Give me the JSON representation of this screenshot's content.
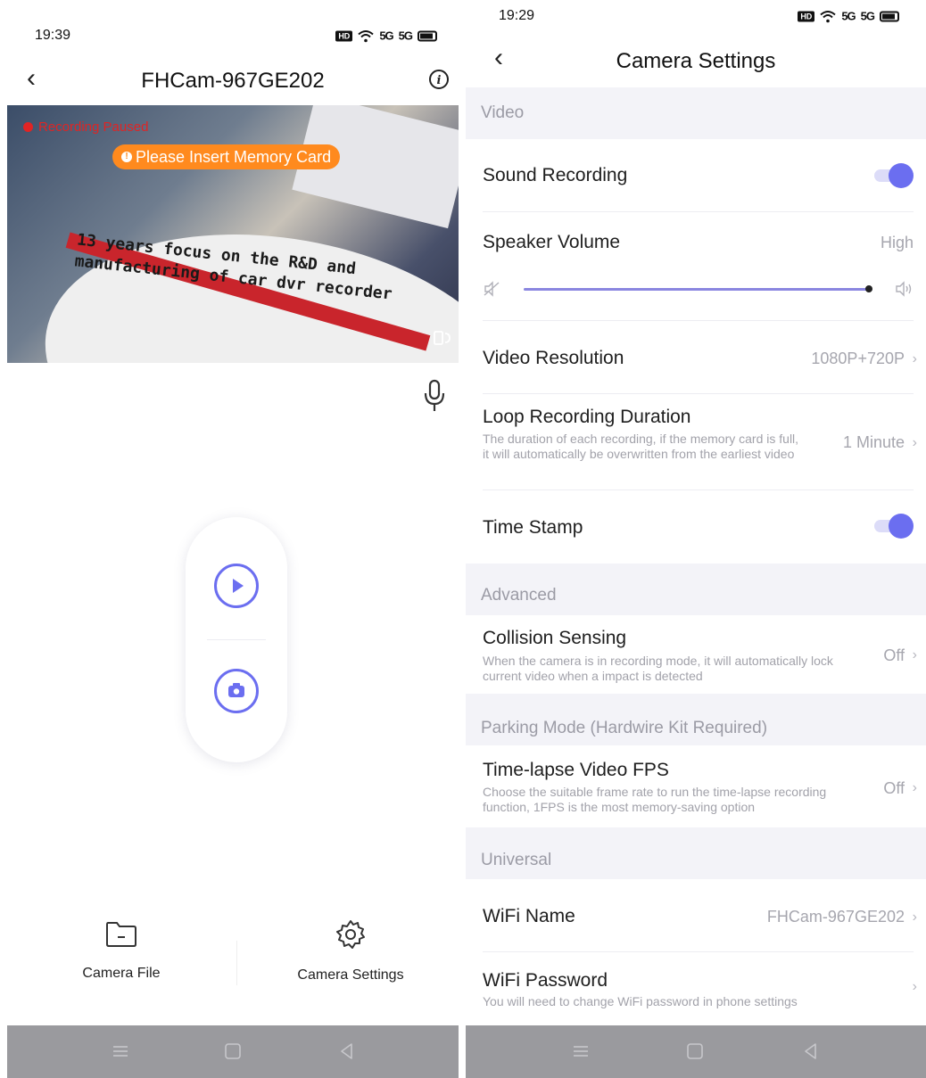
{
  "left": {
    "status": {
      "time": "19:39",
      "hd": "HD",
      "signal1": "5G",
      "signal2": "5G"
    },
    "header": {
      "title": "FHCam-967GE202"
    },
    "video": {
      "rec_status": "Recording Paused",
      "alert": "Please Insert Memory Card",
      "slogan_line1": "13 years focus on the R&D and",
      "slogan_line2": "manufacturing of car dvr recorder"
    },
    "nav": {
      "file_label": "Camera File",
      "settings_label": "Camera Settings"
    }
  },
  "right": {
    "status": {
      "time": "19:29",
      "hd": "HD",
      "signal1": "5G",
      "signal2": "5G"
    },
    "header": {
      "title": "Camera Settings"
    },
    "sections": {
      "video": "Video",
      "advanced": "Advanced",
      "parking": "Parking Mode (Hardwire Kit Required)",
      "universal": "Universal"
    },
    "rows": {
      "sound_recording": {
        "title": "Sound Recording",
        "enabled": true
      },
      "speaker_volume": {
        "title": "Speaker Volume",
        "value": "High",
        "level": 1.0
      },
      "video_resolution": {
        "title": "Video Resolution",
        "value": "1080P+720P"
      },
      "loop_recording": {
        "title": "Loop Recording Duration",
        "desc": "The duration of each recording, if the memory card is full, it will automatically be overwritten from the earliest video",
        "value": "1 Minute"
      },
      "time_stamp": {
        "title": "Time Stamp",
        "enabled": true
      },
      "collision": {
        "title": "Collision Sensing",
        "desc": "When the camera is in recording mode, it will automatically lock current video when a impact is detected",
        "value": "Off"
      },
      "timelapse": {
        "title": "Time-lapse Video FPS",
        "desc": "Choose the suitable frame rate to run the time-lapse recording function, 1FPS is the most memory-saving option",
        "value": "Off"
      },
      "wifi_name": {
        "title": "WiFi Name",
        "value": "FHCam-967GE202"
      },
      "wifi_password": {
        "title": "WiFi Password",
        "desc": "You will need to change WiFi password in phone settings"
      }
    }
  },
  "colors": {
    "accent": "#6b6ef0",
    "alert": "#ff8a1e",
    "recording": "#e02424",
    "section_bg": "#f3f3f8"
  }
}
